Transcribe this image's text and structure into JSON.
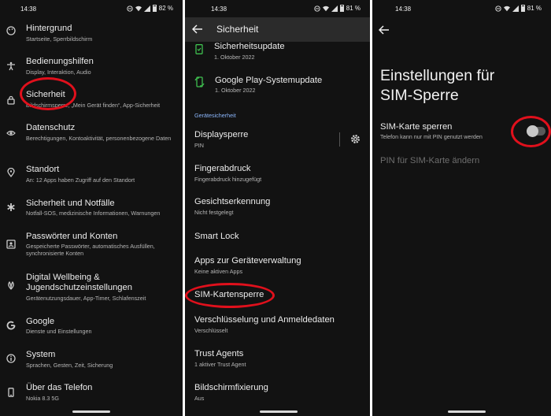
{
  "status": {
    "time": "14:38",
    "battery": [
      "82 %",
      "81 %",
      "81 %"
    ]
  },
  "settings": {
    "items": [
      {
        "title": "Hintergrund",
        "subtitle": "Startseite, Sperrbildschirm",
        "icon": "palette-icon"
      },
      {
        "title": "Bedienungshilfen",
        "subtitle": "Display, Interaktion, Audio",
        "icon": "accessibility-icon"
      },
      {
        "title": "Sicherheit",
        "subtitle": "Bildschirmsperre, „Mein Gerät finden“, App-Sicherheit",
        "icon": "lock-icon"
      },
      {
        "title": "Datenschutz",
        "subtitle": "Berechtigungen, Kontoaktivität, personenbezogene Daten",
        "icon": "eye-icon"
      },
      {
        "title": "Standort",
        "subtitle": "An: 12 Apps haben Zugriff auf den Standort",
        "icon": "location-icon"
      },
      {
        "title": "Sicherheit und Notfälle",
        "subtitle": "Notfall-SOS, medizinische Informationen, Warnungen",
        "icon": "asterisk-icon"
      },
      {
        "title": "Passwörter und Konten",
        "subtitle": "Gespeicherte Passwörter, automatisches Ausfüllen, synchronisierte Konten",
        "icon": "account-box-icon"
      },
      {
        "title": "Digital Wellbeing & Jugendschutzeinstellungen",
        "subtitle": "Gerätenutzungsdauer, App-Timer, Schlafenszeit",
        "icon": "wellbeing-icon"
      },
      {
        "title": "Google",
        "subtitle": "Dienste und Einstellungen",
        "icon": "google-icon"
      },
      {
        "title": "System",
        "subtitle": "Sprachen, Gesten, Zeit, Sicherung",
        "icon": "info-icon"
      },
      {
        "title": "Über das Telefon",
        "subtitle": "Nokia 8.3 5G",
        "icon": "phone-icon"
      }
    ]
  },
  "security": {
    "title": "Sicherheit",
    "top_items": [
      {
        "title": "Sicherheitsupdate",
        "subtitle": "1. Oktober 2022"
      },
      {
        "title": "Google Play-Systemupdate",
        "subtitle": "1. Oktober 2022"
      }
    ],
    "section_header": "Gerätesicherheit",
    "items": [
      {
        "title": "Displaysperre",
        "subtitle": "PIN"
      },
      {
        "title": "Fingerabdruck",
        "subtitle": "Fingerabdruck hinzugefügt"
      },
      {
        "title": "Gesichtserkennung",
        "subtitle": "Nicht festgelegt"
      },
      {
        "title": "Smart Lock",
        "subtitle": ""
      },
      {
        "title": "Apps zur Geräteverwaltung",
        "subtitle": "Keine aktiven Apps"
      },
      {
        "title": "SIM-Kartensperre",
        "subtitle": ""
      },
      {
        "title": "Verschlüsselung und Anmeldedaten",
        "subtitle": "Verschlüsselt"
      },
      {
        "title": "Trust Agents",
        "subtitle": "1 aktiver Trust Agent"
      },
      {
        "title": "Bildschirmfixierung",
        "subtitle": "Aus"
      }
    ]
  },
  "sim": {
    "title_line1": "Einstellungen für",
    "title_line2": "SIM-Sperre",
    "lock_title": "SIM-Karte sperren",
    "lock_subtitle": "Telefon kann nur mit PIN genutzt werden",
    "lock_on": false,
    "change_pin": "PIN für SIM-Karte ändern"
  },
  "colors": {
    "highlight": "#e0101c",
    "accent_green": "#3fbf4f",
    "background": "#121212"
  }
}
